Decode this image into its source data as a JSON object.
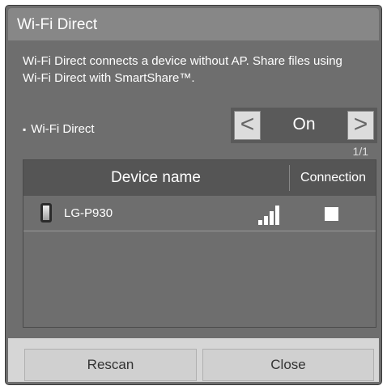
{
  "dialog": {
    "title": "Wi-Fi Direct",
    "description": "Wi-Fi Direct connects a device without AP. Share files using Wi-Fi Direct with SmartShare™."
  },
  "option": {
    "bullet": "▪",
    "label": "Wi-Fi Direct",
    "prev_icon": "<",
    "next_icon": ">",
    "value": "On"
  },
  "page_indicator": "1/1",
  "list": {
    "header_name": "Device name",
    "header_connection": "Connection",
    "devices": [
      {
        "name": "LG-P930",
        "signal_bars": 4,
        "icon": "phone-icon",
        "connected": false
      }
    ]
  },
  "buttons": {
    "rescan": "Rescan",
    "close": "Close"
  },
  "colors": {
    "panel": "#6e6e6e",
    "titlebar": "#878787",
    "header": "#555555",
    "footer": "#d6d6d6"
  }
}
